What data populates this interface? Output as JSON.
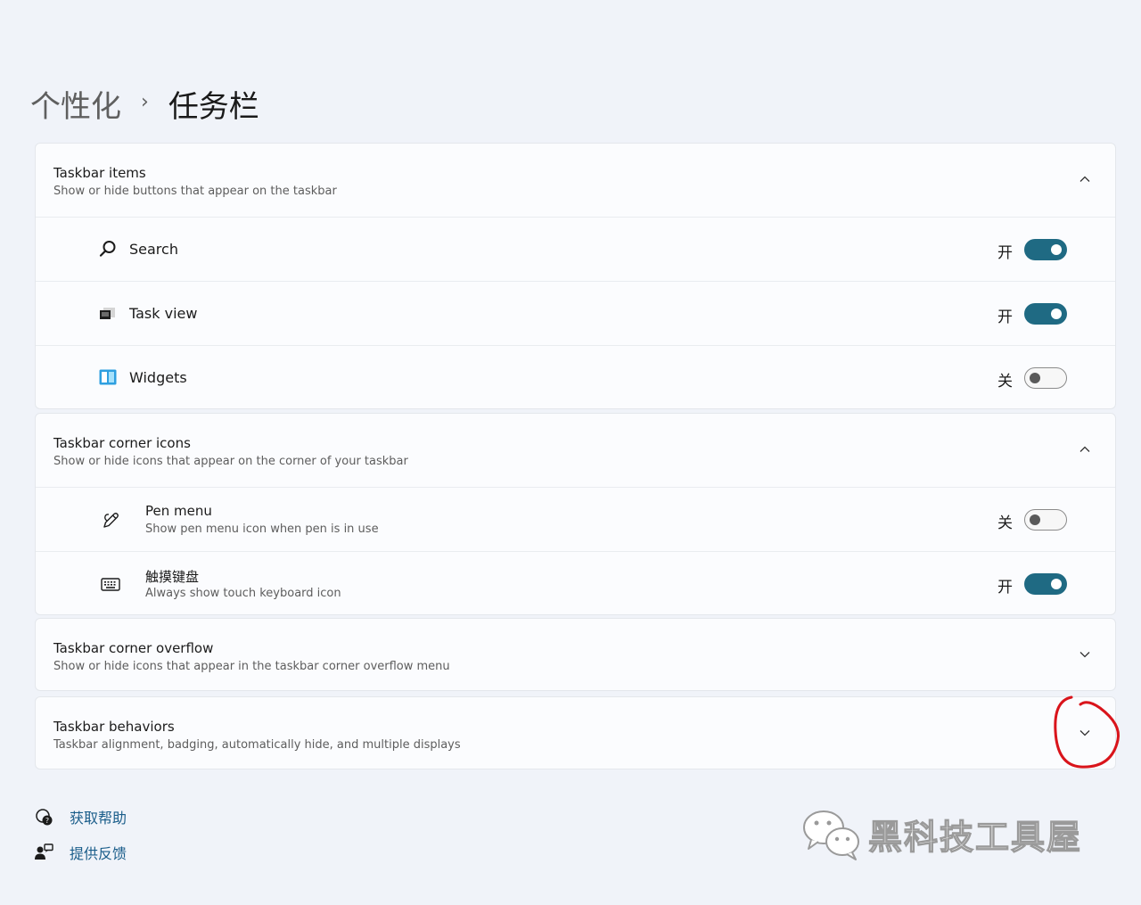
{
  "breadcrumb": {
    "parent": "个性化",
    "separator": "›",
    "current": "任务栏"
  },
  "sections": {
    "taskbar_items": {
      "title": "Taskbar items",
      "subtitle": "Show or hide buttons that appear on the taskbar",
      "expanded": true,
      "items": [
        {
          "label": "Search",
          "icon": "search-icon",
          "state": "开",
          "on": true
        },
        {
          "label": "Task view",
          "icon": "task-view-icon",
          "state": "开",
          "on": true
        },
        {
          "label": "Widgets",
          "icon": "widgets-icon",
          "state": "关",
          "on": false
        }
      ]
    },
    "corner_icons": {
      "title": "Taskbar corner icons",
      "subtitle": "Show or hide icons that appear on the corner of your taskbar",
      "expanded": true,
      "items": [
        {
          "label": "Pen menu",
          "desc": "Show pen menu icon when pen is in use",
          "icon": "pen-icon",
          "state": "关",
          "on": false
        },
        {
          "label": "触摸键盘",
          "desc": "Always show touch keyboard icon",
          "icon": "keyboard-icon",
          "state": "开",
          "on": true
        }
      ]
    },
    "corner_overflow": {
      "title": "Taskbar corner overflow",
      "subtitle": "Show or hide icons that appear in the taskbar corner overflow menu",
      "expanded": false
    },
    "behaviors": {
      "title": "Taskbar behaviors",
      "subtitle": "Taskbar alignment, badging, automatically hide, and multiple displays",
      "expanded": false
    }
  },
  "links": {
    "help": "获取帮助",
    "feedback": "提供反馈"
  },
  "watermark": {
    "text": "黑科技工具屋",
    "icon": "wechat-icon"
  },
  "colors": {
    "accent": "#1f6a83",
    "link": "#1a5d8a",
    "annotation": "#d9141b",
    "background": "#f0f3f9"
  }
}
